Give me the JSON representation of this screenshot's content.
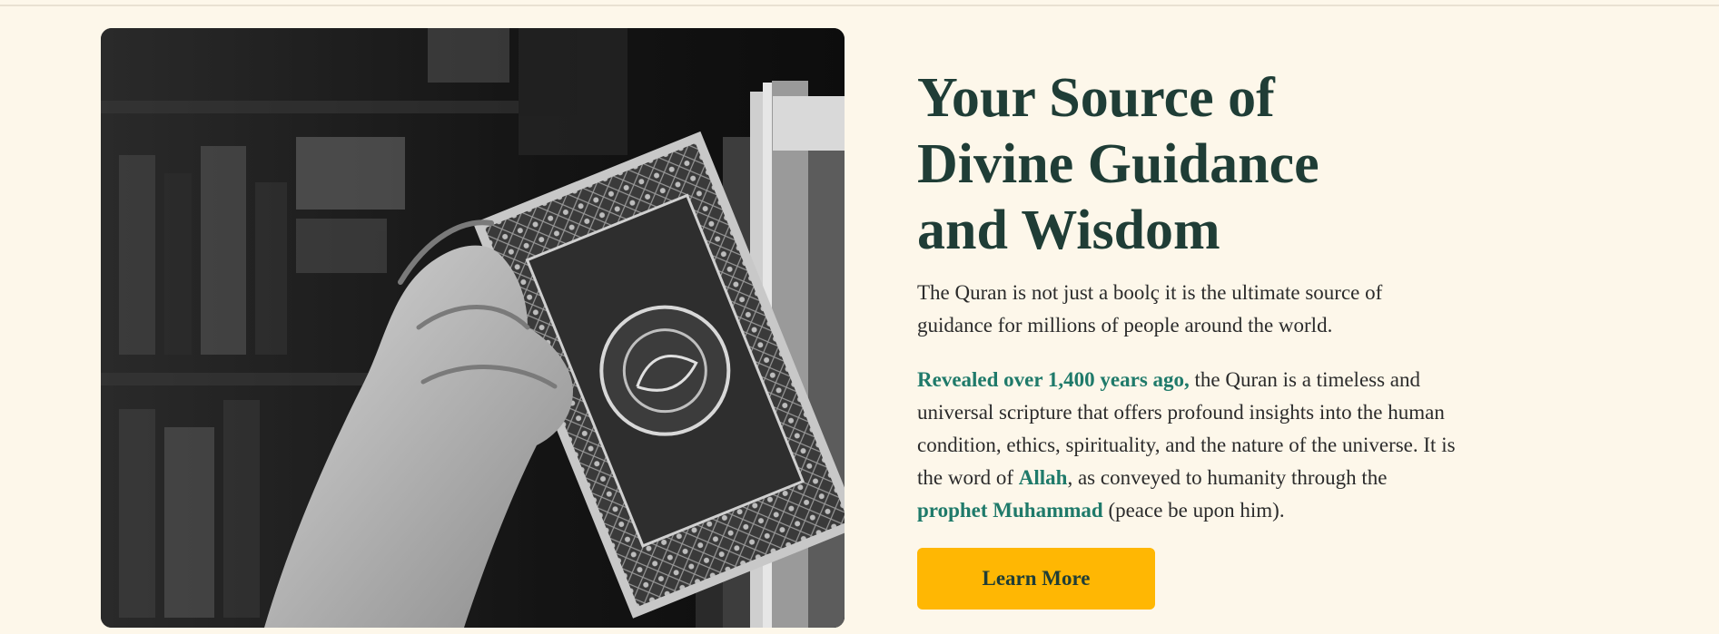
{
  "hero": {
    "image_alt": "Hand pulling an ornate Quran from a bookshelf",
    "title_lines": [
      "Your Source of",
      "Divine Guidance",
      "and Wisdom"
    ],
    "intro": "The Quran is not just a boolç it is the ultimate source of guidance for millions of people around the world.",
    "details": {
      "highlight_1": "Revealed over 1,400 years ago,",
      "text_1": " the Quran is a timeless and universal scripture that offers profound insights into the human condition, ethics, spirituality, and the nature of the universe. It is the word of ",
      "highlight_2": "Allah",
      "text_2": ", as conveyed to humanity through the ",
      "highlight_3": "prophet Muhammad",
      "text_3": " (peace be upon him)."
    },
    "button_label": "Learn More"
  },
  "colors": {
    "background": "#fdf7ea",
    "heading": "#1f3d36",
    "highlight": "#1f7a6a",
    "button": "#ffb703"
  },
  "icons": {
    "book_cover_icon": "quran-cover-icon"
  }
}
